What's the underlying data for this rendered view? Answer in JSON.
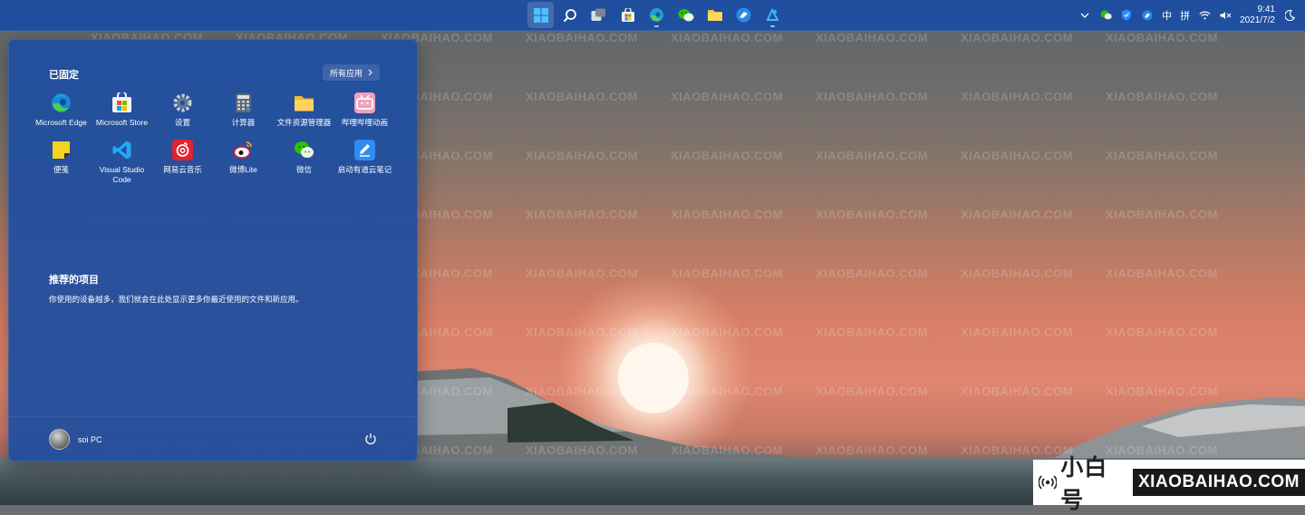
{
  "wallpaper": {
    "watermark_text": "XIAOBAIHAO.COM"
  },
  "taskbar": {
    "icons": [
      "windows-start-icon",
      "search-icon",
      "task-view-icon",
      "microsoft-store-icon",
      "edge-browser-icon",
      "wechat-icon",
      "file-explorer-icon",
      "feishu-icon",
      "app-icon"
    ],
    "tray": {
      "ime_lang": "中",
      "ime_mode": "拼",
      "time": "9:41",
      "date": "2021/7/2"
    }
  },
  "start_menu": {
    "pinned_title": "已固定",
    "all_apps_label": "所有应用",
    "apps": [
      {
        "label": "Microsoft Edge",
        "icon": "edge-icon"
      },
      {
        "label": "Microsoft Store",
        "icon": "store-icon"
      },
      {
        "label": "设置",
        "icon": "settings-gear-icon"
      },
      {
        "label": "计算器",
        "icon": "calculator-icon"
      },
      {
        "label": "文件资源管理器",
        "icon": "folder-icon"
      },
      {
        "label": "哔哩哔哩动画",
        "icon": "bilibili-icon"
      },
      {
        "label": "便笺",
        "icon": "sticky-notes-icon"
      },
      {
        "label": "Visual Studio Code",
        "icon": "vscode-icon"
      },
      {
        "label": "网易云音乐",
        "icon": "netease-music-icon"
      },
      {
        "label": "微博Lite",
        "icon": "weibo-icon"
      },
      {
        "label": "微信",
        "icon": "wechat-icon"
      },
      {
        "label": "启动有道云笔记",
        "icon": "youdao-note-icon"
      }
    ],
    "recommended_title": "推荐的项目",
    "recommended_text": "你使用的设备越多，我们就会在此处显示更多你最近使用的文件和新应用。",
    "user_name": "soi PC"
  },
  "badge": {
    "cn": "小白号",
    "en": "XIAOBAIHAO.COM"
  },
  "colors": {
    "taskbar": "#1f4f9e",
    "start_menu": "#1e4ea0",
    "accent": "#4ea0ff"
  }
}
